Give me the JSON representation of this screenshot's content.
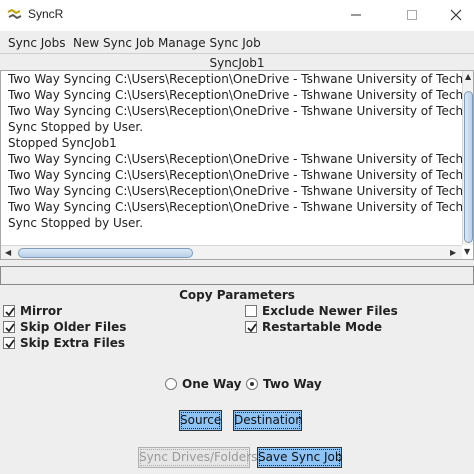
{
  "window": {
    "title": "SyncR",
    "app_icon": "syncr-app-icon",
    "controls": [
      "minimize-icon",
      "maximize-icon",
      "close-icon"
    ]
  },
  "menu": {
    "items": [
      "Sync Jobs",
      "New Sync Job",
      "Manage Sync Job"
    ]
  },
  "job": {
    "title": "SyncJob1"
  },
  "log": {
    "lines": [
      "Two Way Syncing C:\\Users\\Reception\\OneDrive - Tshwane University of Technology",
      "Two Way Syncing C:\\Users\\Reception\\OneDrive - Tshwane University of Technology",
      "Two Way Syncing C:\\Users\\Reception\\OneDrive - Tshwane University of Technology",
      "Sync Stopped by User.",
      "Stopped SyncJob1",
      "Two Way Syncing C:\\Users\\Reception\\OneDrive - Tshwane University of Technology",
      "Two Way Syncing C:\\Users\\Reception\\OneDrive - Tshwane University of Technology",
      "Two Way Syncing C:\\Users\\Reception\\OneDrive - Tshwane University of Technology",
      "Two Way Syncing C:\\Users\\Reception\\OneDrive - Tshwane University of Technology",
      "Sync Stopped by User."
    ]
  },
  "status": {
    "value": ""
  },
  "params": {
    "title": "Copy Parameters",
    "mirror": {
      "label": "Mirror",
      "checked": true
    },
    "skip_older": {
      "label": "Skip Older Files",
      "checked": true
    },
    "skip_extra": {
      "label": "Skip Extra Files",
      "checked": true
    },
    "exclude_newer": {
      "label": "Exclude Newer Files",
      "checked": false
    },
    "restartable": {
      "label": "Restartable Mode",
      "checked": true
    }
  },
  "direction": {
    "one_way": {
      "label": "One Way",
      "selected": false
    },
    "two_way": {
      "label": "Two Way",
      "selected": true
    }
  },
  "buttons": {
    "source": "Source",
    "destination": "Destination",
    "sync_drives": "Sync Drives/Folders",
    "save": "Save Sync Job"
  },
  "colors": {
    "button_accent": "#8dc3f5",
    "scroll_thumb": "#b8cfe6",
    "disabled_text": "#9a9a9a"
  }
}
